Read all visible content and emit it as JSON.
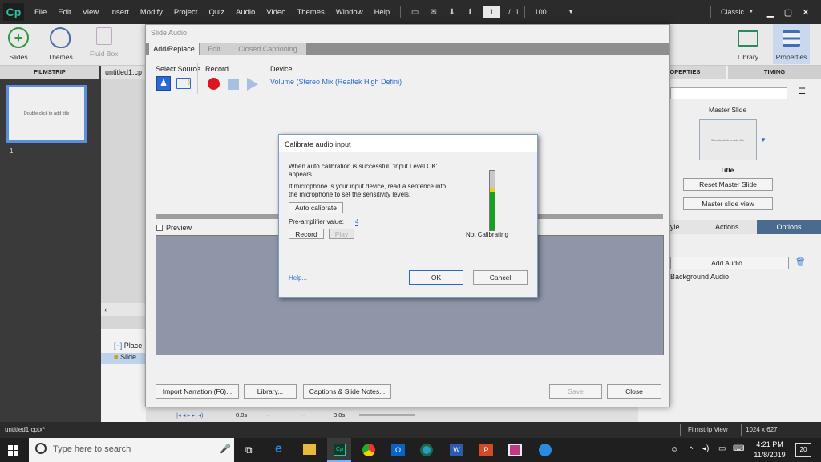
{
  "app": {
    "logo": "Cp",
    "menu": [
      "File",
      "Edit",
      "View",
      "Insert",
      "Modify",
      "Project",
      "Quiz",
      "Audio",
      "Video",
      "Themes",
      "Window",
      "Help"
    ],
    "page_current": "1",
    "page_sep": "/",
    "page_total": "1",
    "zoom": "100",
    "workspace": "Classic"
  },
  "toolbar": {
    "slides": "Slides",
    "themes": "Themes",
    "fluid_box": "Fluid Box",
    "library": "Library",
    "properties": "Properties"
  },
  "filmstrip": {
    "title": "FILMSTRIP",
    "thumb_text": "Double click to add title",
    "slide_num": "1"
  },
  "document_tab": "untitled1.cp",
  "timeline": {
    "rows": [
      "Place",
      "Slide"
    ],
    "time_start": "0.0s",
    "time_dash1": "--",
    "time_dash2": "--",
    "duration": "3.0s"
  },
  "right_panel": {
    "tab_properties": "ROPERTIES",
    "tab_timing": "TIMING",
    "master_slide_label": "Master Slide",
    "master_thumb_text": "Double click to add title",
    "master_name": "Title",
    "reset_master": "Reset Master Slide",
    "master_view": "Master slide view",
    "tab_style": "yle",
    "tab_actions": "Actions",
    "tab_options": "Options",
    "add_audio": "Add Audio...",
    "background_audio": "Background Audio"
  },
  "slide_audio": {
    "title": "Slide Audio",
    "tab_add": "Add/Replace",
    "tab_edit": "Edit",
    "tab_cc": "Closed Captioning",
    "select_source": "Select Source",
    "record": "Record",
    "device": "Device",
    "device_value": "Volume (Stereo Mix (Realtek High Defini)",
    "preview": "Preview",
    "import_narration": "Import Narration (F6)...",
    "library": "Library...",
    "captions": "Captions & Slide Notes...",
    "save": "Save",
    "close": "Close"
  },
  "calibrate": {
    "title": "Calibrate audio input",
    "line1": "When auto calibration is successful, 'Input Level OK'",
    "line2": "appears.",
    "line3": "If microphone is your input device, read a sentence into",
    "line4": "the microphone to set the sensitivity levels.",
    "auto_calibrate": "Auto calibrate",
    "preamp_label": "Pre-amplifier value:",
    "preamp_value": "4",
    "record": "Record",
    "play": "Play",
    "status": "Not Calibrating",
    "help": "Help...",
    "ok": "OK",
    "cancel": "Cancel"
  },
  "statusbar": {
    "file": "untitled1.cptx*",
    "view": "Filmstrip View",
    "size": "1024 x 627"
  },
  "taskbar": {
    "search_placeholder": "Type here to search",
    "time": "4:21 PM",
    "date": "11/8/2019",
    "notif": "20"
  },
  "colors": {
    "accent_blue": "#1f6fd0",
    "record_red": "#e0141e",
    "meter_green": "#1aa020",
    "menubar": "#2b2b2b"
  }
}
